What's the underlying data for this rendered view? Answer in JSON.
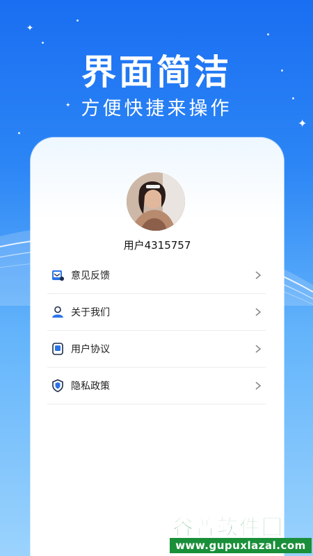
{
  "hero": {
    "title": "界面简洁",
    "subtitle": "方便快捷来操作"
  },
  "profile": {
    "username": "用户4315757"
  },
  "menu": {
    "items": [
      {
        "label": "意见反馈",
        "icon": "feedback-icon"
      },
      {
        "label": "关于我们",
        "icon": "user-icon"
      },
      {
        "label": "用户协议",
        "icon": "document-icon"
      },
      {
        "label": "隐私政策",
        "icon": "shield-icon"
      }
    ]
  },
  "watermark": {
    "title": "谷普软件园",
    "url": "www.gupuxlazal.com"
  },
  "colors": {
    "background_top": "#1a6ef2",
    "background_bottom": "#9bd3fd",
    "card": "#ffffff",
    "icon_blue": "#2a73e8",
    "icon_dark": "#1d2b4a",
    "watermark_green": "#1a8f3a"
  }
}
